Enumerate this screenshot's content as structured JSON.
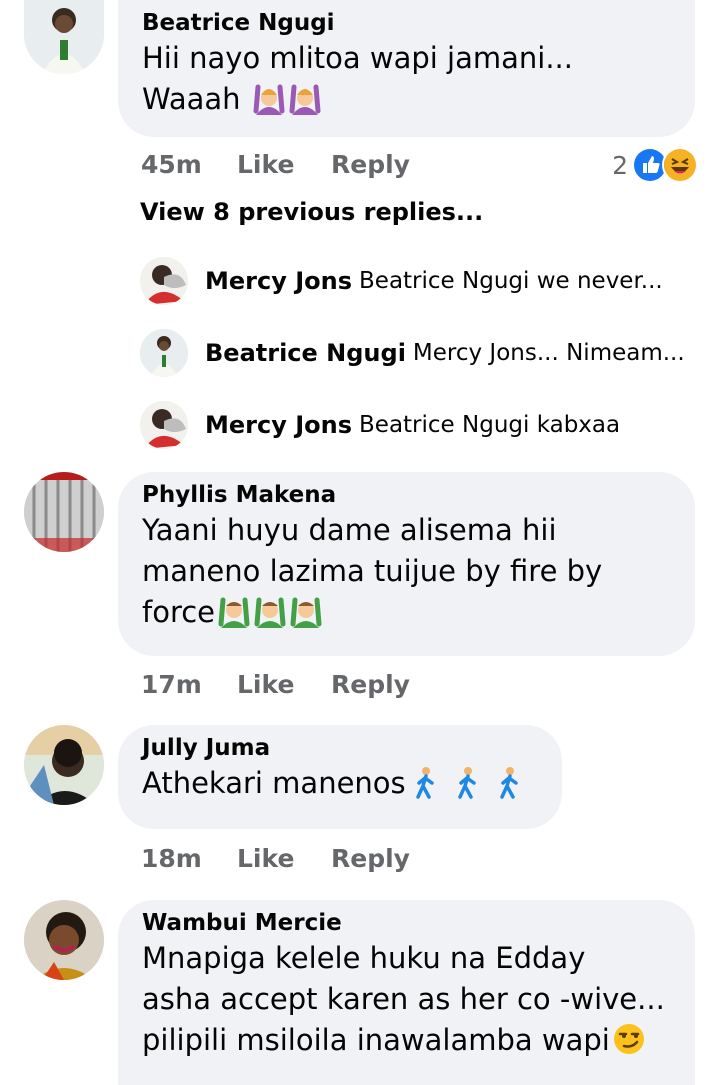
{
  "comments": [
    {
      "name": "Beatrice Ngugi",
      "lines": [
        "Hii nayo mlitoa wapi jamani...",
        "Waaah"
      ],
      "emoji": [
        "woman-raising-hands-icon",
        "woman-raising-hands-icon"
      ],
      "time": "45m",
      "like": "Like",
      "reply": "Reply",
      "reaction_count": "2",
      "reactions": [
        "like-reaction-icon",
        "haha-reaction-icon"
      ]
    },
    {
      "name": "Phyllis Makena",
      "lines": [
        "Yaani huyu dame alisema hii",
        "maneno lazima tuijue by fire by",
        "force"
      ],
      "emoji": [
        "man-raising-hands-icon",
        "man-raising-hands-icon",
        "man-raising-hands-icon"
      ],
      "time": "17m",
      "like": "Like",
      "reply": "Reply"
    },
    {
      "name": "Jully Juma",
      "lines": [
        "Athekari manenos"
      ],
      "emoji": [
        "person-walking-icon",
        "person-walking-icon",
        "person-walking-icon"
      ],
      "time": "18m",
      "like": "Like",
      "reply": "Reply"
    },
    {
      "name": "Wambui Mercie",
      "lines": [
        "Mnapiga kelele huku na Edday",
        "asha accept karen as her co -wive...",
        "pilipili msiloila inawalamba wapi"
      ],
      "emoji": [
        "smirking-face-icon"
      ]
    }
  ],
  "view_previous": "View 8 previous replies...",
  "replies": [
    {
      "name": "Mercy Jons",
      "text": "Beatrice Ngugi we never..."
    },
    {
      "name": "Beatrice Ngugi",
      "text": "Mercy Jons... Nimeam..."
    },
    {
      "name": "Mercy Jons",
      "text": "Beatrice Ngugi kabxaa"
    }
  ],
  "colors": {
    "bubble": "#f0f2f5",
    "meta_text": "#65676b",
    "like_blue": "#1877f2",
    "haha_yellow": "#f7b125"
  }
}
